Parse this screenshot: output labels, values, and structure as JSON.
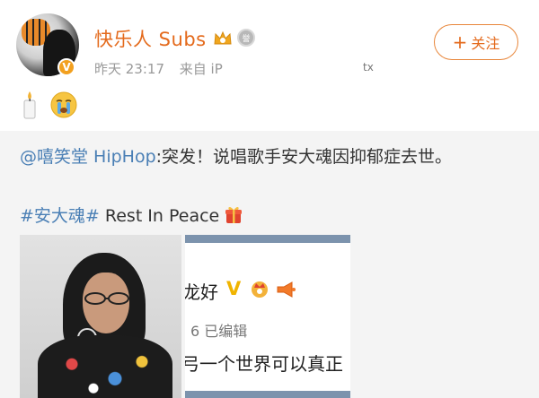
{
  "post": {
    "username": "快乐人 Subs",
    "time": "昨天 23:17",
    "source": "来自 iP",
    "tx_mark": "tx",
    "follow_label": "关注",
    "follow_plus": "+",
    "badge_icon": "verified-v-icon",
    "medal_label": "誉",
    "emojis": [
      "candle-emoji",
      "crying-emoji"
    ]
  },
  "repost": {
    "mention": "@嘻笑堂 HipHop",
    "text": ":突发！说唱歌手安大魂因抑郁症去世。",
    "hashtag": "#安大魂#",
    "hashtag_tail": " Rest In Peace",
    "gift_icon": "gift-icon"
  },
  "images": {
    "screenshot": {
      "name_fragment": "龙好",
      "v_badge": "V",
      "edit_line": "6 已编辑",
      "body_fragment": "弓一个世界可以真正"
    }
  },
  "colors": {
    "username": "#e46a1c",
    "link": "#4a7fb5",
    "follow_border": "#e8863a",
    "repost_bg": "#f4f4f4",
    "meta": "#999999"
  }
}
